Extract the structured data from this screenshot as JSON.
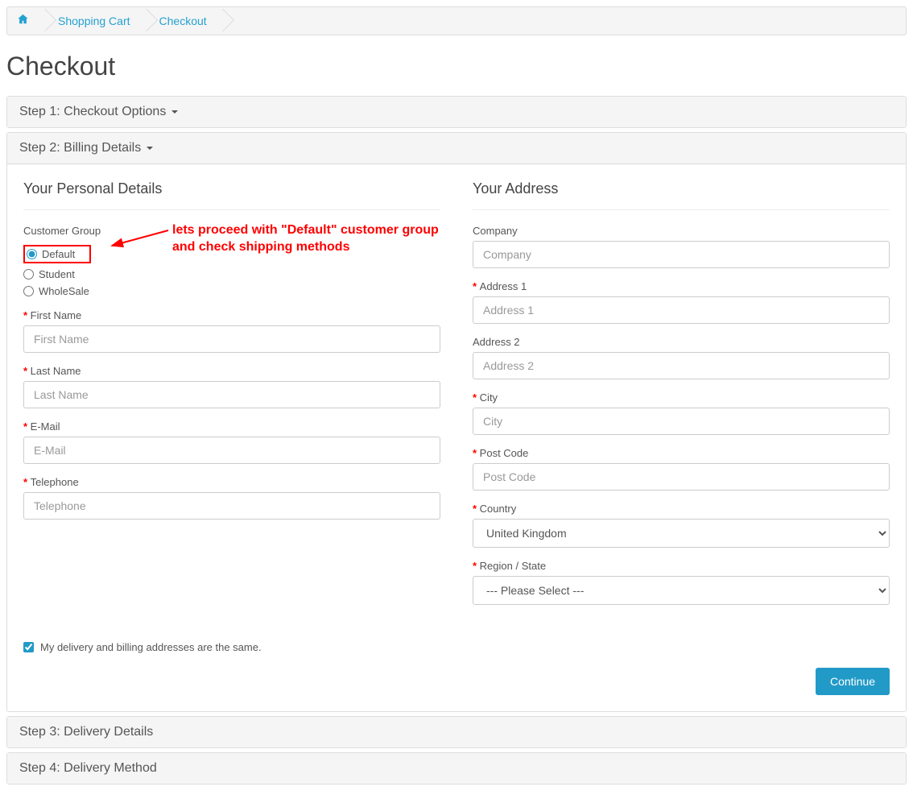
{
  "breadcrumb": {
    "home_title": "Home",
    "items": [
      "Shopping Cart",
      "Checkout"
    ]
  },
  "page_title": "Checkout",
  "panels": {
    "step1": "Step 1: Checkout Options ",
    "step2": "Step 2: Billing Details ",
    "step3": "Step 3: Delivery Details",
    "step4": "Step 4: Delivery Method"
  },
  "personal": {
    "heading": "Your Personal Details",
    "customer_group_label": "Customer Group",
    "groups": {
      "default": "Default",
      "student": "Student",
      "wholesale": "WholeSale"
    },
    "first_name_label": "First Name",
    "first_name_placeholder": "First Name",
    "last_name_label": "Last Name",
    "last_name_placeholder": "Last Name",
    "email_label": "E-Mail",
    "email_placeholder": "E-Mail",
    "telephone_label": "Telephone",
    "telephone_placeholder": "Telephone"
  },
  "address": {
    "heading": "Your Address",
    "company_label": "Company",
    "company_placeholder": "Company",
    "address1_label": "Address 1",
    "address1_placeholder": "Address 1",
    "address2_label": "Address 2",
    "address2_placeholder": "Address 2",
    "city_label": "City",
    "city_placeholder": "City",
    "postcode_label": "Post Code",
    "postcode_placeholder": "Post Code",
    "country_label": "Country",
    "country_value": "United Kingdom",
    "region_label": "Region / State",
    "region_value": "--- Please Select ---"
  },
  "same_address_label": "My delivery and billing addresses are the same.",
  "continue_button": "Continue",
  "annotation": {
    "line1": "lets proceed with \"Default\" customer group",
    "line2": "and check shipping methods"
  }
}
